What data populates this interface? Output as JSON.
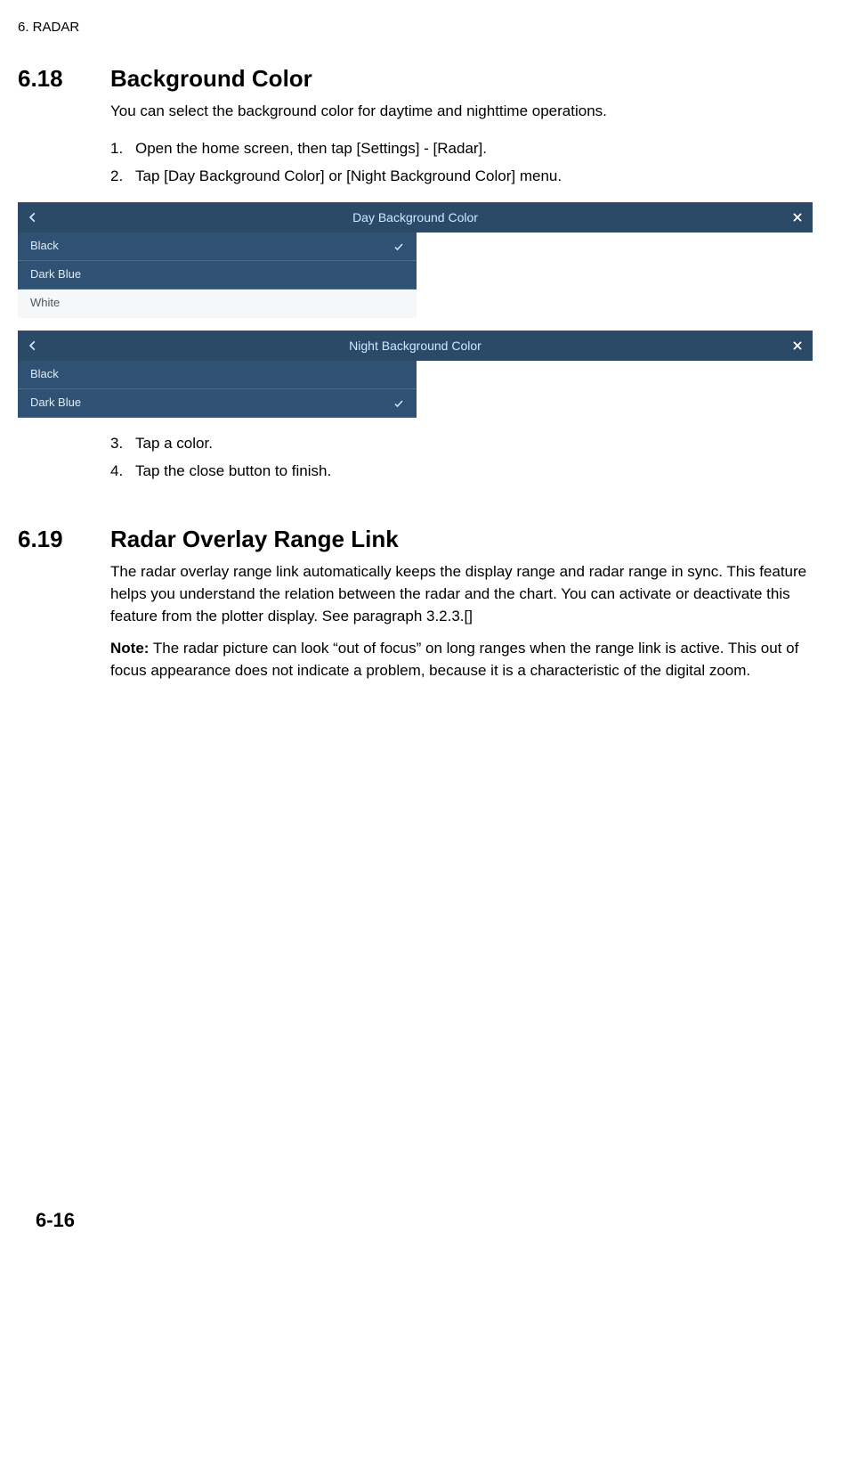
{
  "header": "6.  RADAR",
  "sections": {
    "s618": {
      "num": "6.18",
      "title": "Background Color",
      "intro": "You can select the background color for daytime and nighttime operations.",
      "steps_a": [
        "Open the home screen, then tap [Settings] - [Radar].",
        "Tap [Day Background Color] or [Night Background Color] menu."
      ],
      "steps_b": [
        "Tap a color.",
        "Tap the close button to finish."
      ]
    },
    "s619": {
      "num": "6.19",
      "title": "Radar Overlay Range Link",
      "body": "The radar overlay range link automatically keeps the display range and radar range in sync. This feature helps you understand the relation between the radar and the chart. You can activate or deactivate this feature from the plotter display. See paragraph 3.2.3.[]",
      "note_label": "Note:",
      "note_body": " The radar picture can look “out of focus” on long ranges when the range link is active. This out of focus appearance does not indicate a problem, because it is a characteristic of the digital zoom."
    }
  },
  "figures": {
    "day": {
      "title": "Day Background Color",
      "items": [
        "Black",
        "Dark Blue",
        "White"
      ],
      "selected_index": 0
    },
    "night": {
      "title": "Night Background Color",
      "items": [
        "Black",
        "Dark Blue"
      ],
      "selected_index": 1
    }
  },
  "page_number": "6-16"
}
